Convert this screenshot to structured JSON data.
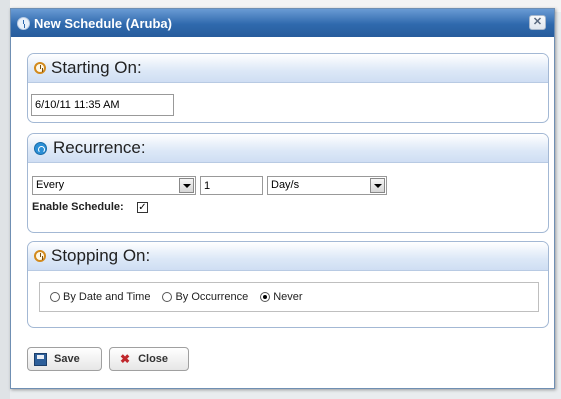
{
  "dialog": {
    "title": "New Schedule (Aruba)",
    "close_glyph": "✕"
  },
  "starting_on": {
    "header": "Starting On:",
    "icon": "clock-icon",
    "datetime_value": "6/10/11 11:35 AM"
  },
  "recurrence": {
    "header": "Recurrence:",
    "icon": "recurrence-icon",
    "frequency_value": "Every",
    "interval_value": "1",
    "unit_value": "Day/s",
    "enable_label": "Enable Schedule:",
    "enable_checked": true,
    "check_glyph": "✓"
  },
  "stopping_on": {
    "header": "Stopping On:",
    "icon": "clock-icon",
    "options": [
      {
        "label": "By Date and Time",
        "selected": false
      },
      {
        "label": "By Occurrence",
        "selected": false
      },
      {
        "label": "Never",
        "selected": true
      }
    ]
  },
  "buttons": {
    "save_label": "Save",
    "close_label": "Close",
    "close_glyph": "✖"
  },
  "colors": {
    "titlebar": "#2f69ad",
    "section_header": "#dce8f7",
    "close_icon": "#c0282d"
  }
}
